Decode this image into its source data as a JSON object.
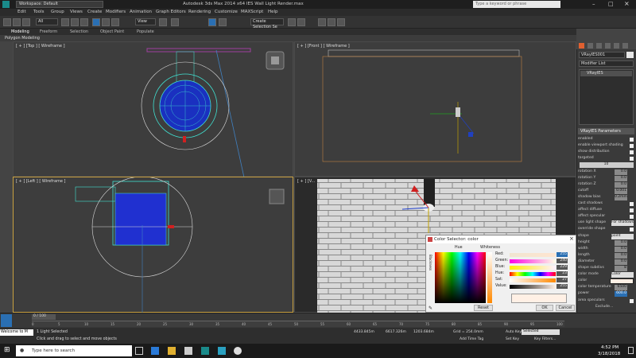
{
  "window": {
    "title": "Autodesk 3ds Max  2014 x64      IES Wall Light Render.max",
    "workspace": "Workspace: Default",
    "search_placeholder": "Type a keyword or phrase"
  },
  "menu": [
    "Edit",
    "Tools",
    "Group",
    "Views",
    "Create",
    "Modifiers",
    "Animation",
    "Graph Editors",
    "Rendering",
    "Customize",
    "MAXScript",
    "Help"
  ],
  "toolbar": {
    "filter": "All",
    "view": "View",
    "selection_set": "Create Selection Se"
  },
  "ribbon": {
    "tabs": [
      "Modeling",
      "Freeform",
      "Selection",
      "Object Paint",
      "Populate"
    ],
    "sub": "Polygon Modeling"
  },
  "viewports": {
    "top": "[ + ] [Top ] [ Wireframe ]",
    "front": "[ + ] [Front ] [ Wireframe ]",
    "left": "[ + ] [Left ] [ Wireframe ]",
    "persp": "[ + ] [V..."
  },
  "command_panel": {
    "object_name": "VRayIES001",
    "modifier_list": "Modifier List",
    "stack_item": "VRayIES",
    "rollout": "VRayIES Parameters",
    "params": [
      {
        "label": "enabled",
        "type": "check"
      },
      {
        "label": "enable viewport shading",
        "type": "check"
      },
      {
        "label": "show distribution",
        "type": "check"
      },
      {
        "label": "targeted",
        "type": "check"
      },
      {
        "label": "",
        "type": "value",
        "value": "10"
      },
      {
        "label": "rotation X",
        "type": "num",
        "value": "0.0"
      },
      {
        "label": "rotation Y",
        "type": "num",
        "value": "0.0"
      },
      {
        "label": "rotation Z",
        "type": "num",
        "value": "0.0"
      },
      {
        "label": "cutoff",
        "type": "num",
        "value": "0.001"
      },
      {
        "label": "shadow bias",
        "type": "num",
        "value": "0.2mm"
      },
      {
        "label": "cast shadows",
        "type": "check"
      },
      {
        "label": "affect diffuse",
        "type": "check"
      },
      {
        "label": "affect specular",
        "type": "check"
      },
      {
        "label": "use light shape",
        "type": "select",
        "value": "For shadows"
      },
      {
        "label": "override shape",
        "type": "check"
      },
      {
        "label": "shape",
        "type": "select",
        "value": "point"
      },
      {
        "label": "height",
        "type": "num",
        "value": "0.0"
      },
      {
        "label": "width",
        "type": "num",
        "value": "0.0"
      },
      {
        "label": "length",
        "type": "num",
        "value": "0.0"
      },
      {
        "label": "diameter",
        "type": "num",
        "value": "0.0"
      },
      {
        "label": "shape subdivs",
        "type": "num",
        "value": "8"
      },
      {
        "label": "color mode",
        "type": "select",
        "value": "Color"
      },
      {
        "label": "color",
        "type": "swatch"
      },
      {
        "label": "color temperature",
        "type": "num",
        "value": "6500"
      },
      {
        "label": "power",
        "type": "num",
        "value": "600.0"
      },
      {
        "label": "area speculars",
        "type": "check"
      },
      {
        "label": "Exclude...",
        "type": "button"
      }
    ],
    "bottom_rollout": "mental ray Indirect Illumination"
  },
  "color_dialog": {
    "title": "Color Selector: color",
    "hue_label": "Hue",
    "whiteness_label": "Whiteness",
    "blackness_label": "Blackness",
    "channels": [
      {
        "label": "Red:",
        "value": "255"
      },
      {
        "label": "Green:",
        "value": "240"
      },
      {
        "label": "Blue:",
        "value": "229"
      },
      {
        "label": "Hue:",
        "value": "23"
      },
      {
        "label": "Sat:",
        "value": "27"
      },
      {
        "label": "Value:",
        "value": "255"
      }
    ],
    "reset": "Reset",
    "ok": "OK",
    "cancel": "Cancel",
    "current_color": "#fff0e5"
  },
  "timeline": {
    "frame": "0 / 100",
    "ticks": [
      "0",
      "5",
      "10",
      "15",
      "20",
      "25",
      "30",
      "35",
      "40",
      "45",
      "50",
      "55",
      "60",
      "65",
      "70",
      "75",
      "80",
      "85",
      "90",
      "95",
      "100"
    ]
  },
  "status": {
    "selected": "1 Light Selected",
    "prompt": "Click and drag to select and move objects",
    "x": "4433.845m",
    "y": "6617.326m",
    "z": "1203.684m",
    "grid": "Grid = 254.0mm",
    "add_time_tag": "Add Time Tag",
    "auto_key": "Auto Key",
    "auto_key_value": "Selected",
    "set_key": "Set Key",
    "key_filters": "Key Filters...",
    "maxscript": "Welcome to M"
  },
  "taskbar": {
    "search": "Type here to search",
    "time": "4:52 PM",
    "date": "3/18/2018"
  },
  "colors": {
    "accent": "#c8a040",
    "selected_blue": "#2a6fb3",
    "light_cyan": "#40e0d0"
  }
}
